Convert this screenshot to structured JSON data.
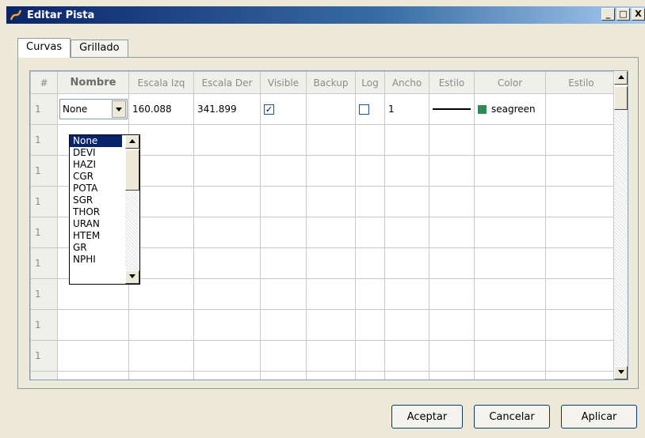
{
  "window": {
    "title": "Editar Pista"
  },
  "title_buttons": {
    "minimize": "_",
    "maximize": "□",
    "close": "X"
  },
  "tabs": [
    {
      "label": "Curvas",
      "active": true
    },
    {
      "label": "Grillado",
      "active": false
    }
  ],
  "table": {
    "headers": [
      "#",
      "Nombre",
      "Escala Izq",
      "Escala Der",
      "Visible",
      "Backup",
      "Log",
      "Ancho",
      "Estilo",
      "Color",
      "Estilo"
    ],
    "row1": {
      "num": "1",
      "nombre": "None",
      "escala_izq": "160.088",
      "escala_der": "341.899",
      "visible_checked": true,
      "log_checked": false,
      "ancho": "1",
      "color_name": "seagreen",
      "color_hex": "#2e8b57"
    },
    "row_numbers": [
      "1",
      "1",
      "1",
      "1",
      "1",
      "1",
      "1",
      "1",
      "1"
    ]
  },
  "dropdown": {
    "options": [
      "None",
      "DEVI",
      "HAZI",
      "CGR",
      "POTA",
      "SGR",
      "THOR",
      "URAN",
      "HTEM",
      "GR",
      "NPHI"
    ],
    "selected": "None"
  },
  "buttons": {
    "accept": "Aceptar",
    "cancel": "Cancelar",
    "apply": "Aplicar"
  },
  "icons": {
    "app": "app-logo-icon",
    "combo_arrow": "triangle-down",
    "scroll_up": "triangle-up",
    "scroll_down": "triangle-down"
  }
}
